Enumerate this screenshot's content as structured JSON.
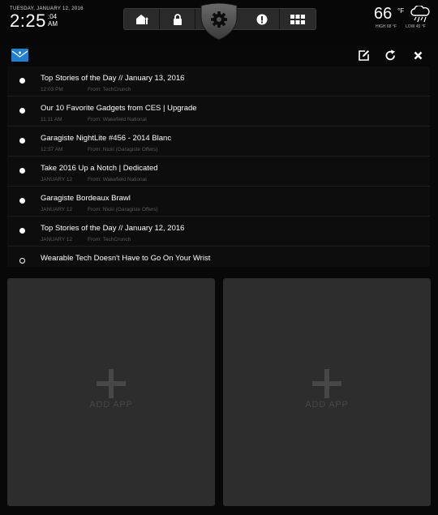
{
  "header": {
    "date": "TUESDAY, JANUARY 12, 2016",
    "time": "2:25",
    "seconds": ":04",
    "ampm": "AM"
  },
  "nav": {
    "buttons": [
      {
        "name": "home-icon"
      },
      {
        "name": "lock-icon"
      },
      {
        "name": "alert-icon"
      },
      {
        "name": "grid-icon"
      }
    ],
    "center": {
      "name": "gear-icon"
    }
  },
  "weather": {
    "temp": "66",
    "unit": "°F",
    "high": "HIGH 68 °F",
    "low": "LOW 45 °F",
    "icon": "snow-cloud-icon"
  },
  "toolbar": {
    "mail_icon": "mail-icon",
    "compose_icon": "compose-icon",
    "refresh_icon": "refresh-icon",
    "close_icon": "close-icon"
  },
  "emails": [
    {
      "subject": "Top Stories of the Day // January 13, 2016",
      "when": "12:03 PM",
      "from": "From: TechCrunch",
      "unread": true
    },
    {
      "subject": "Our 10 Favorite Gadgets from CES | Upgrade",
      "when": "11:11 AM",
      "from": "From: Wakefield National",
      "unread": true
    },
    {
      "subject": "Garagiste NightLite #456 - 2014 Blanc",
      "when": "12:57 AM",
      "from": "From: Nicki (Garagiste Offers)",
      "unread": true
    },
    {
      "subject": "Take 2016 Up a Notch | Dedicated",
      "when": "JANUARY 12",
      "from": "From: Wakefield National",
      "unread": true
    },
    {
      "subject": "Garagiste Bordeaux Brawl",
      "when": "JANUARY 12",
      "from": "From: Nicki (Garagiste Offers)",
      "unread": true
    },
    {
      "subject": "Top Stories of the Day // January 12, 2016",
      "when": "JANUARY 12",
      "from": "From: TechCrunch",
      "unread": true
    },
    {
      "subject": "Wearable Tech Doesn't Have to Go On Your Wrist",
      "when": "",
      "from": "",
      "unread": false
    }
  ],
  "tiles": [
    {
      "label": "ADD APP"
    },
    {
      "label": "ADD APP"
    }
  ],
  "colors": {
    "accent_blue": "#1f7fd0",
    "tile_bg": "#2d2d2d",
    "tile_text": "#474747"
  }
}
